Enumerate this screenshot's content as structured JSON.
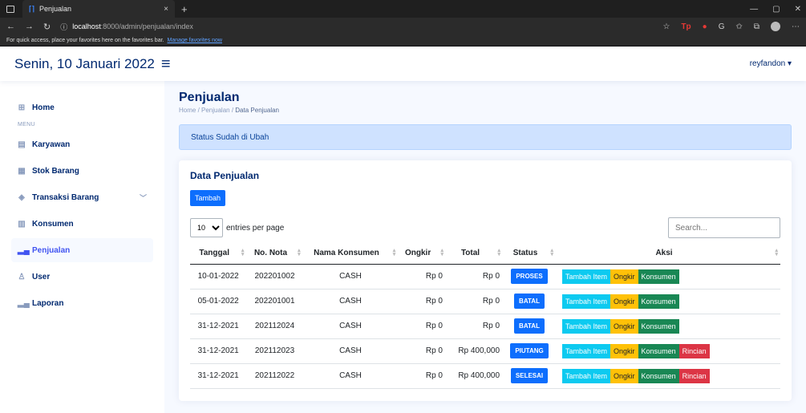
{
  "browser": {
    "tab_title": "Penjualan",
    "tab_close": "×",
    "new_tab": "+",
    "url_host": "localhost",
    "url_path": ":8000/admin/penjualan/index",
    "favbar_text": "For quick access, place your favorites here on the favorites bar.",
    "favbar_link": "Manage favorites now"
  },
  "header": {
    "date": "Senin, 10 Januari 2022",
    "user": "reyfandon ▾"
  },
  "sidebar": {
    "home": "Home",
    "menu_heading": "MENU",
    "items": [
      {
        "label": "Karyawan",
        "icon": "▤"
      },
      {
        "label": "Stok Barang",
        "icon": "▦"
      },
      {
        "label": "Transaksi Barang",
        "icon": "◈"
      },
      {
        "label": "Konsumen",
        "icon": "▥"
      },
      {
        "label": "Penjualan",
        "icon": "▁"
      },
      {
        "label": "User",
        "icon": "♙"
      },
      {
        "label": "Laporan",
        "icon": "▁"
      }
    ]
  },
  "page": {
    "title": "Penjualan",
    "breadcrumb_home": "Home",
    "breadcrumb_penjualan": "Penjualan",
    "breadcrumb_current": "Data Penjualan",
    "alert": "Status Sudah di Ubah"
  },
  "card": {
    "title": "Data Penjualan",
    "add_button": "Tambah",
    "entries_value": "10",
    "entries_label": "entries per page",
    "search_placeholder": "Search..."
  },
  "table": {
    "headers": [
      "Tanggal",
      "No. Nota",
      "Nama Konsumen",
      "Ongkir",
      "Total",
      "Status",
      "Aksi"
    ],
    "rows": [
      {
        "tanggal": "10-01-2022",
        "nota": "202201002",
        "konsumen": "CASH",
        "ongkir": "Rp 0",
        "total": "Rp 0",
        "status": "PROSES",
        "rincian": false
      },
      {
        "tanggal": "05-01-2022",
        "nota": "202201001",
        "konsumen": "CASH",
        "ongkir": "Rp 0",
        "total": "Rp 0",
        "status": "BATAL",
        "rincian": false
      },
      {
        "tanggal": "31-12-2021",
        "nota": "202112024",
        "konsumen": "CASH",
        "ongkir": "Rp 0",
        "total": "Rp 0",
        "status": "BATAL",
        "rincian": false
      },
      {
        "tanggal": "31-12-2021",
        "nota": "202112023",
        "konsumen": "CASH",
        "ongkir": "Rp 0",
        "total": "Rp 400,000",
        "status": "PIUTANG",
        "rincian": true
      },
      {
        "tanggal": "31-12-2021",
        "nota": "202112022",
        "konsumen": "CASH",
        "ongkir": "Rp 0",
        "total": "Rp 400,000",
        "status": "SELESAI",
        "rincian": true
      }
    ],
    "actions": {
      "tambah_item": "Tambah Item",
      "ongkir": "Ongkir",
      "konsumen": "Konsumen",
      "rincian": "Rincian"
    }
  },
  "colors": {
    "PROSES": "#0d6efd",
    "BATAL": "#0d6efd",
    "PIUTANG": "#0d6efd",
    "SELESAI": "#0d6efd"
  }
}
